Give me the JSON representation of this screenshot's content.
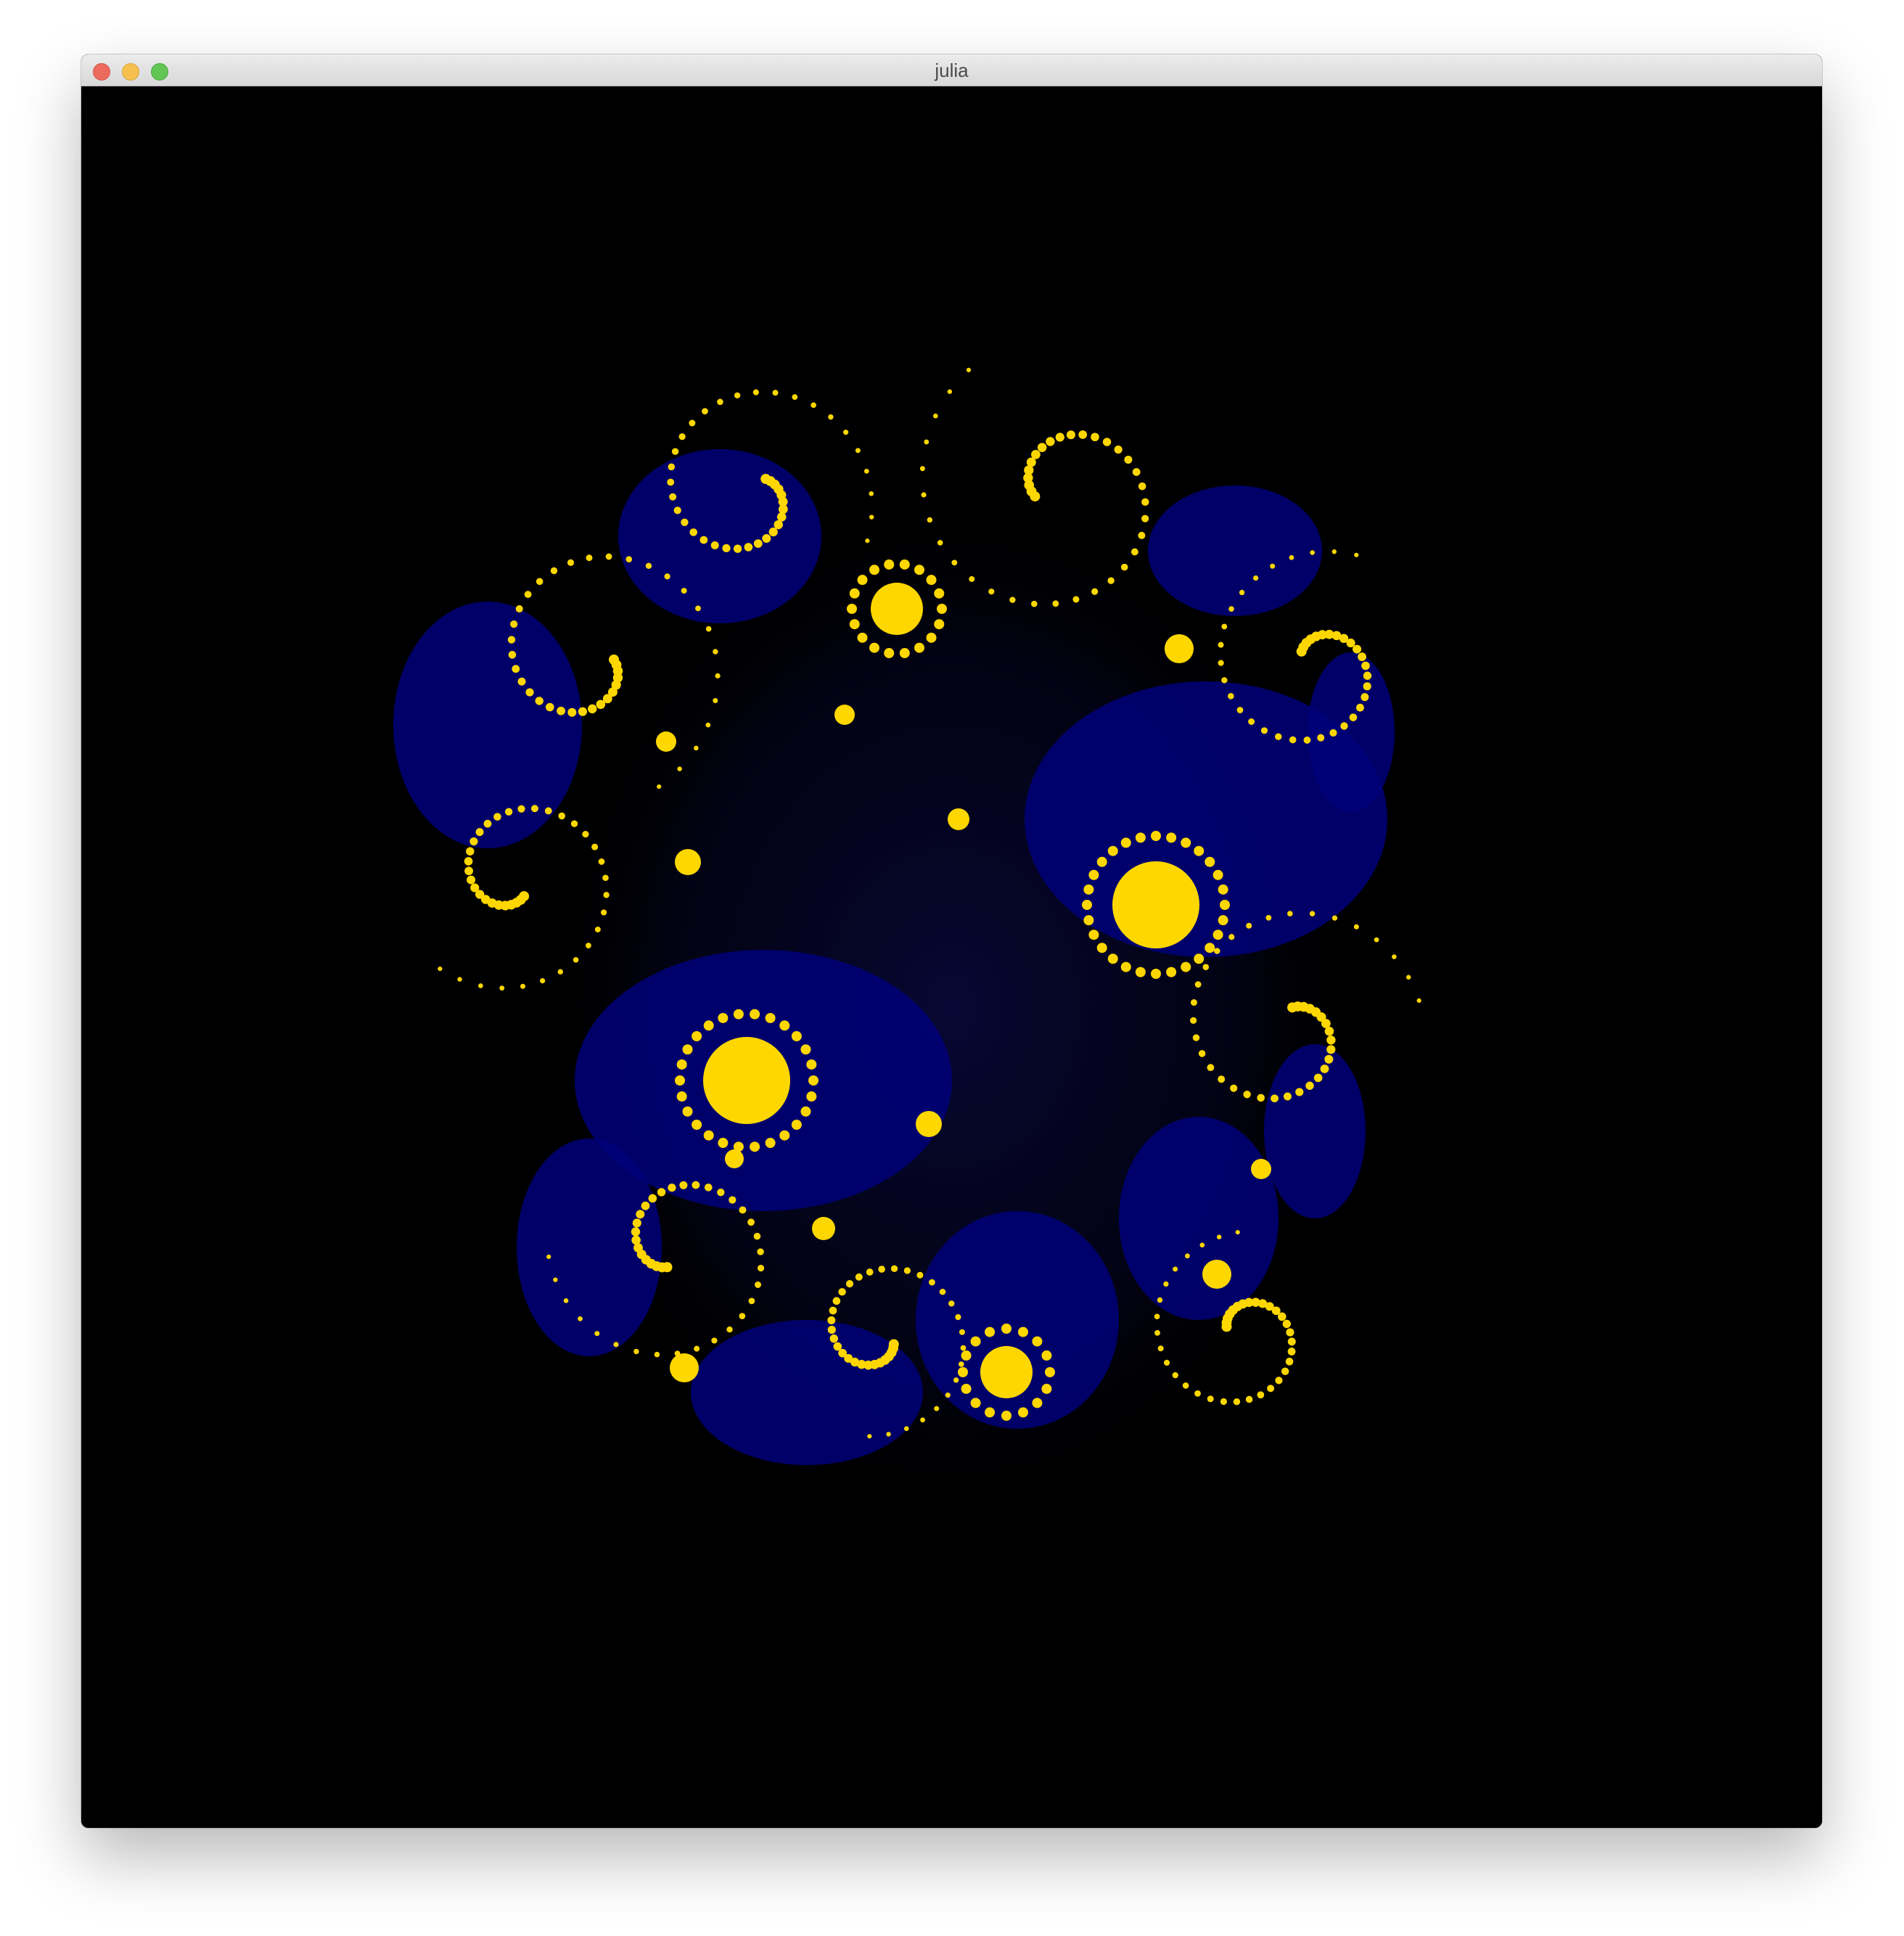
{
  "window": {
    "title": "julia"
  },
  "colors": {
    "background": "#000000",
    "fractal_fill": "#00007a",
    "fractal_glow": "#0a0a5a",
    "basin_yellow": "#ffd700",
    "close": "#ed6a5e",
    "minimize": "#f5c04f",
    "zoom": "#62c655"
  },
  "icons": {
    "close": "close-traffic-light-icon",
    "minimize": "minimize-traffic-light-icon",
    "zoom": "zoom-traffic-light-icon"
  }
}
